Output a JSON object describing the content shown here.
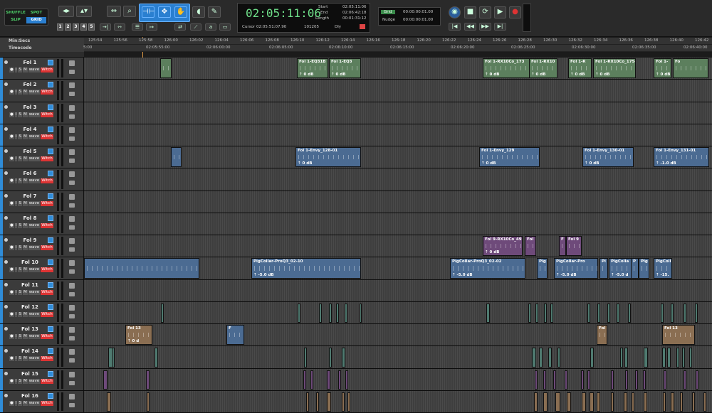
{
  "edit_modes": {
    "shuffle": "SHUFFLE",
    "spot": "SPOT",
    "slip": "SLIP",
    "grid": "GRID"
  },
  "zoom_presets": [
    "1",
    "2",
    "3",
    "4",
    "5"
  ],
  "counter": {
    "main": "02:05:11:06",
    "start_label": "Start",
    "end_label": "End",
    "length_label": "Length",
    "start": "02:05:11:06",
    "end": "02:06:42:18",
    "length": "00:01:31:12",
    "cursor_label": "Cursor",
    "cursor": "02:05:51:07.90",
    "cursor_extra": "101205",
    "dly": "Dly"
  },
  "grid_nudge": {
    "grid_label": "Grid",
    "grid_value": "00:00:00:01.00",
    "nudge_label": "Nudge",
    "nudge_value": "00:00:00:01.00"
  },
  "rulers": {
    "minsecs_label": "Min:Secs",
    "timecode_label": "Timecode",
    "minsecs_ticks": [
      "125:54",
      "125:56",
      "125:58",
      "126:00",
      "126:02",
      "126:04",
      "126:06",
      "126:08",
      "126:10",
      "126:12",
      "126:14",
      "126:16",
      "126:18",
      "126:20",
      "126:22",
      "126:24",
      "126:26",
      "126:28",
      "126:30",
      "126:32",
      "126:34",
      "126:36",
      "126:38",
      "126:40",
      "126:42"
    ],
    "timecode_ticks": [
      "5:00",
      "02:05:55:00",
      "02:06:00:00",
      "02:06:05:00",
      "02:06:10:00",
      "02:06:15:00",
      "02:06:20:00",
      "02:06:25:00",
      "02:06:30:00",
      "02:06:35:00",
      "02:06:40:00"
    ]
  },
  "track_buttons": {
    "input": "I",
    "solo": "S",
    "mute": "M",
    "view": "wave",
    "automation": "Witch"
  },
  "tracks": [
    {
      "name": "Fol 1",
      "color": "#2f8cd8",
      "clips": [
        {
          "title": "",
          "gain": "",
          "color": "green"
        },
        {
          "title": "Fol 1-EQ31B",
          "gain": "0 dB",
          "color": "green"
        },
        {
          "title": "Fol 1-EQ3",
          "gain": "0 dB",
          "color": "green"
        },
        {
          "title": "Fol 1-RX10Co_173",
          "gain": "0 dB",
          "color": "green"
        },
        {
          "title": "Fol 1-RX10",
          "gain": "0 dB",
          "color": "green"
        },
        {
          "title": "Fol 1-R",
          "gain": "0 dB",
          "color": "green"
        },
        {
          "title": "Fol 1-RX10Co_175-",
          "gain": "0 dB",
          "color": "green"
        },
        {
          "title": "Fol 1-",
          "gain": "0 dB",
          "color": "green"
        },
        {
          "title": "Fo",
          "gain": "",
          "color": "green"
        }
      ]
    },
    {
      "name": "Fol 2",
      "color": "#2f8cd8",
      "clips": []
    },
    {
      "name": "Fol 3",
      "color": "#2f8cd8",
      "clips": []
    },
    {
      "name": "Fol 4",
      "color": "#2f8cd8",
      "clips": []
    },
    {
      "name": "Fol 5",
      "color": "#2f8cd8",
      "clips": [
        {
          "title": "",
          "gain": "",
          "color": "blue"
        },
        {
          "title": "Fol 1-Envy_128-01",
          "gain": "0 dB",
          "color": "blue"
        },
        {
          "title": "Fol 1-Envy_129",
          "gain": "0 dB",
          "color": "blue"
        },
        {
          "title": "Fol 1-Envy_130-01",
          "gain": "0 dB",
          "color": "blue"
        },
        {
          "title": "Fol 1-Envy_131-01",
          "gain": "-1.0 dB",
          "color": "blue"
        }
      ]
    },
    {
      "name": "Fol 6",
      "color": "#2f8cd8",
      "clips": []
    },
    {
      "name": "Fol 7",
      "color": "#2f8cd8",
      "clips": []
    },
    {
      "name": "Fol 8",
      "color": "#2f8cd8",
      "clips": []
    },
    {
      "name": "Fol 9",
      "color": "#2f8cd8",
      "clips": [
        {
          "title": "Fol 9-RX10Co_49",
          "gain": "0 dB",
          "color": "purple"
        },
        {
          "title": "Fol",
          "gain": "",
          "color": "purple"
        },
        {
          "title": "F",
          "gain": "",
          "color": "purple"
        },
        {
          "title": "Fol 9",
          "gain": "",
          "color": "purple"
        }
      ]
    },
    {
      "name": "Fol 10",
      "color": "#2f8cd8",
      "clips": [
        {
          "title": "",
          "gain": "",
          "color": "blue"
        },
        {
          "title": "PigCollar-ProQ3_02-10",
          "gain": "-5.0 dB",
          "color": "blue"
        },
        {
          "title": "PigCollar-ProQ3_02-02",
          "gain": "-5.0 dB",
          "color": "blue"
        },
        {
          "title": "Pig",
          "gain": "",
          "color": "blue"
        },
        {
          "title": "PigCollar-Pro",
          "gain": "-5.0 dB",
          "color": "blue"
        },
        {
          "title": "Pi",
          "gain": "",
          "color": "blue"
        },
        {
          "title": "PigColla",
          "gain": "-5.0 d",
          "color": "blue"
        },
        {
          "title": "P",
          "gain": "",
          "color": "blue"
        },
        {
          "title": "Pig",
          "gain": "",
          "color": "blue"
        },
        {
          "title": "PigColl",
          "gain": "-15.",
          "color": "blue"
        }
      ]
    },
    {
      "name": "Fol 11",
      "color": "#2f8cd8",
      "clips": []
    },
    {
      "name": "Fol 12",
      "color": "#2f8cd8",
      "clips": []
    },
    {
      "name": "Fol 13",
      "color": "#2f8cd8",
      "clips": [
        {
          "title": "Fol 13",
          "gain": "0 d",
          "color": "tan"
        },
        {
          "title": "F",
          "gain": "",
          "color": "blue"
        },
        {
          "title": "Fol",
          "gain": "",
          "color": "tan"
        },
        {
          "title": "Fol 13",
          "gain": "",
          "color": "tan"
        }
      ]
    },
    {
      "name": "Fol 14",
      "color": "#2f8cd8",
      "clips": []
    },
    {
      "name": "Fol 15",
      "color": "#2f8cd8",
      "clips": []
    },
    {
      "name": "Fol 16",
      "color": "#2f8cd8",
      "clips": []
    }
  ]
}
